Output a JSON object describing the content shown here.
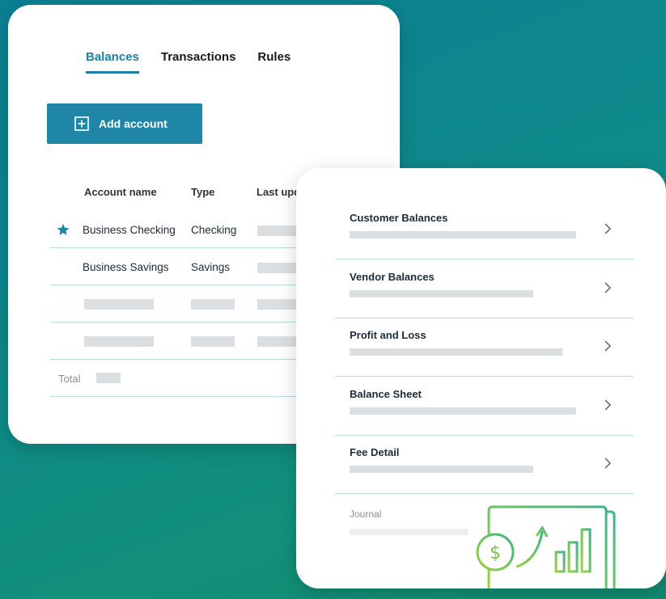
{
  "tabs": [
    {
      "label": "Balances",
      "active": true
    },
    {
      "label": "Transactions",
      "active": false
    },
    {
      "label": "Rules",
      "active": false
    }
  ],
  "add_account": {
    "label": "Add account"
  },
  "table": {
    "columns": [
      "Account name",
      "Type",
      "Last upd"
    ],
    "rows": [
      {
        "name": "Business Checking",
        "type": "Checking",
        "starred": true
      },
      {
        "name": "Business Savings",
        "type": "Savings",
        "starred": false
      }
    ],
    "total_label": "Total"
  },
  "reports": [
    {
      "title": "Customer Balances"
    },
    {
      "title": "Vendor Balances"
    },
    {
      "title": "Profit and Loss"
    },
    {
      "title": "Balance Sheet"
    },
    {
      "title": "Fee Detail"
    },
    {
      "title": "Journal"
    }
  ],
  "colors": {
    "accent": "#1f86a8",
    "icon_green": "#7dc242",
    "bg_teal": "#0e8a8a"
  },
  "icons": [
    "plus-square-icon",
    "star-icon",
    "chevron-right-icon",
    "dollar-growth-chart-icon"
  ]
}
